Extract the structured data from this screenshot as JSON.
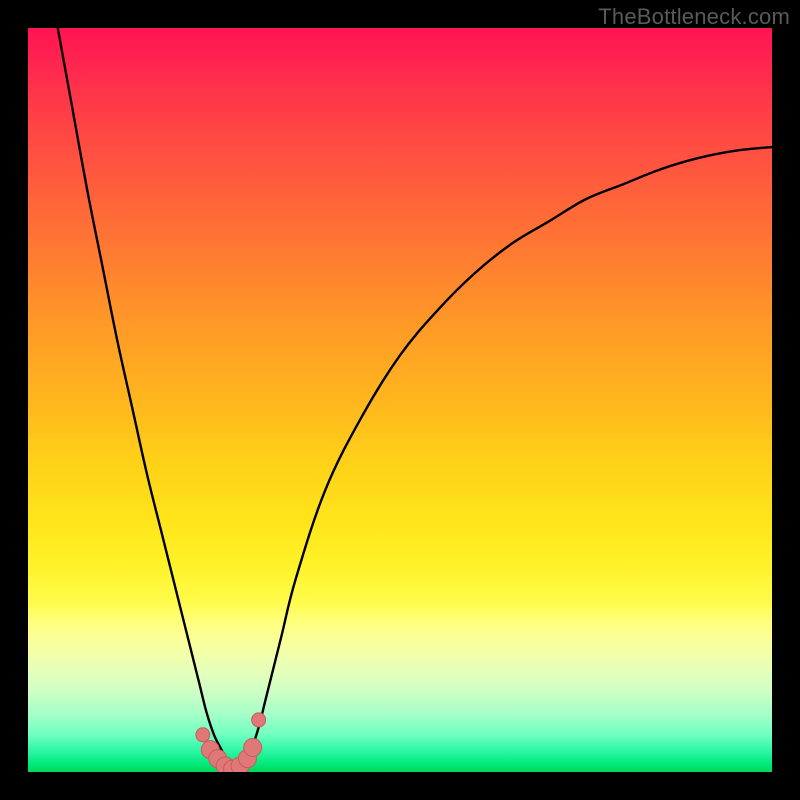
{
  "watermark": {
    "text": "TheBottleneck.com"
  },
  "colors": {
    "frame": "#000000",
    "curve_stroke": "#000000",
    "marker_fill": "#e07878",
    "marker_stroke": "#c85a5a"
  },
  "chart_data": {
    "type": "line",
    "title": "",
    "xlabel": "",
    "ylabel": "",
    "xlim": [
      0,
      100
    ],
    "ylim": [
      0,
      100
    ],
    "grid": false,
    "legend": null,
    "note": "bottleneck-style V curve; minimum near x≈27; y interpreted as bottleneck % (0 at bottom)",
    "series": [
      {
        "name": "bottleneck_curve",
        "x": [
          4,
          6,
          8,
          10,
          12,
          14,
          16,
          18,
          20,
          22,
          23,
          24,
          25,
          26,
          27,
          28,
          29,
          30,
          31,
          32,
          34,
          36,
          40,
          45,
          50,
          55,
          60,
          65,
          70,
          75,
          80,
          85,
          90,
          95,
          100
        ],
        "y": [
          100,
          89,
          78,
          68,
          58,
          49,
          40,
          32,
          24,
          16,
          12,
          8,
          5,
          3,
          1,
          0,
          1,
          3,
          6,
          10,
          18,
          26,
          38,
          48,
          56,
          62,
          67,
          71,
          74,
          77,
          79,
          81,
          82.5,
          83.5,
          84
        ]
      }
    ],
    "markers": {
      "name": "near_min_markers",
      "x": [
        23.5,
        24.5,
        25.5,
        26.5,
        27.5,
        28.5,
        29.5,
        30.2,
        31.0
      ],
      "y": [
        5.0,
        3.0,
        1.8,
        0.8,
        0.4,
        0.8,
        1.8,
        3.3,
        7.0
      ]
    }
  }
}
